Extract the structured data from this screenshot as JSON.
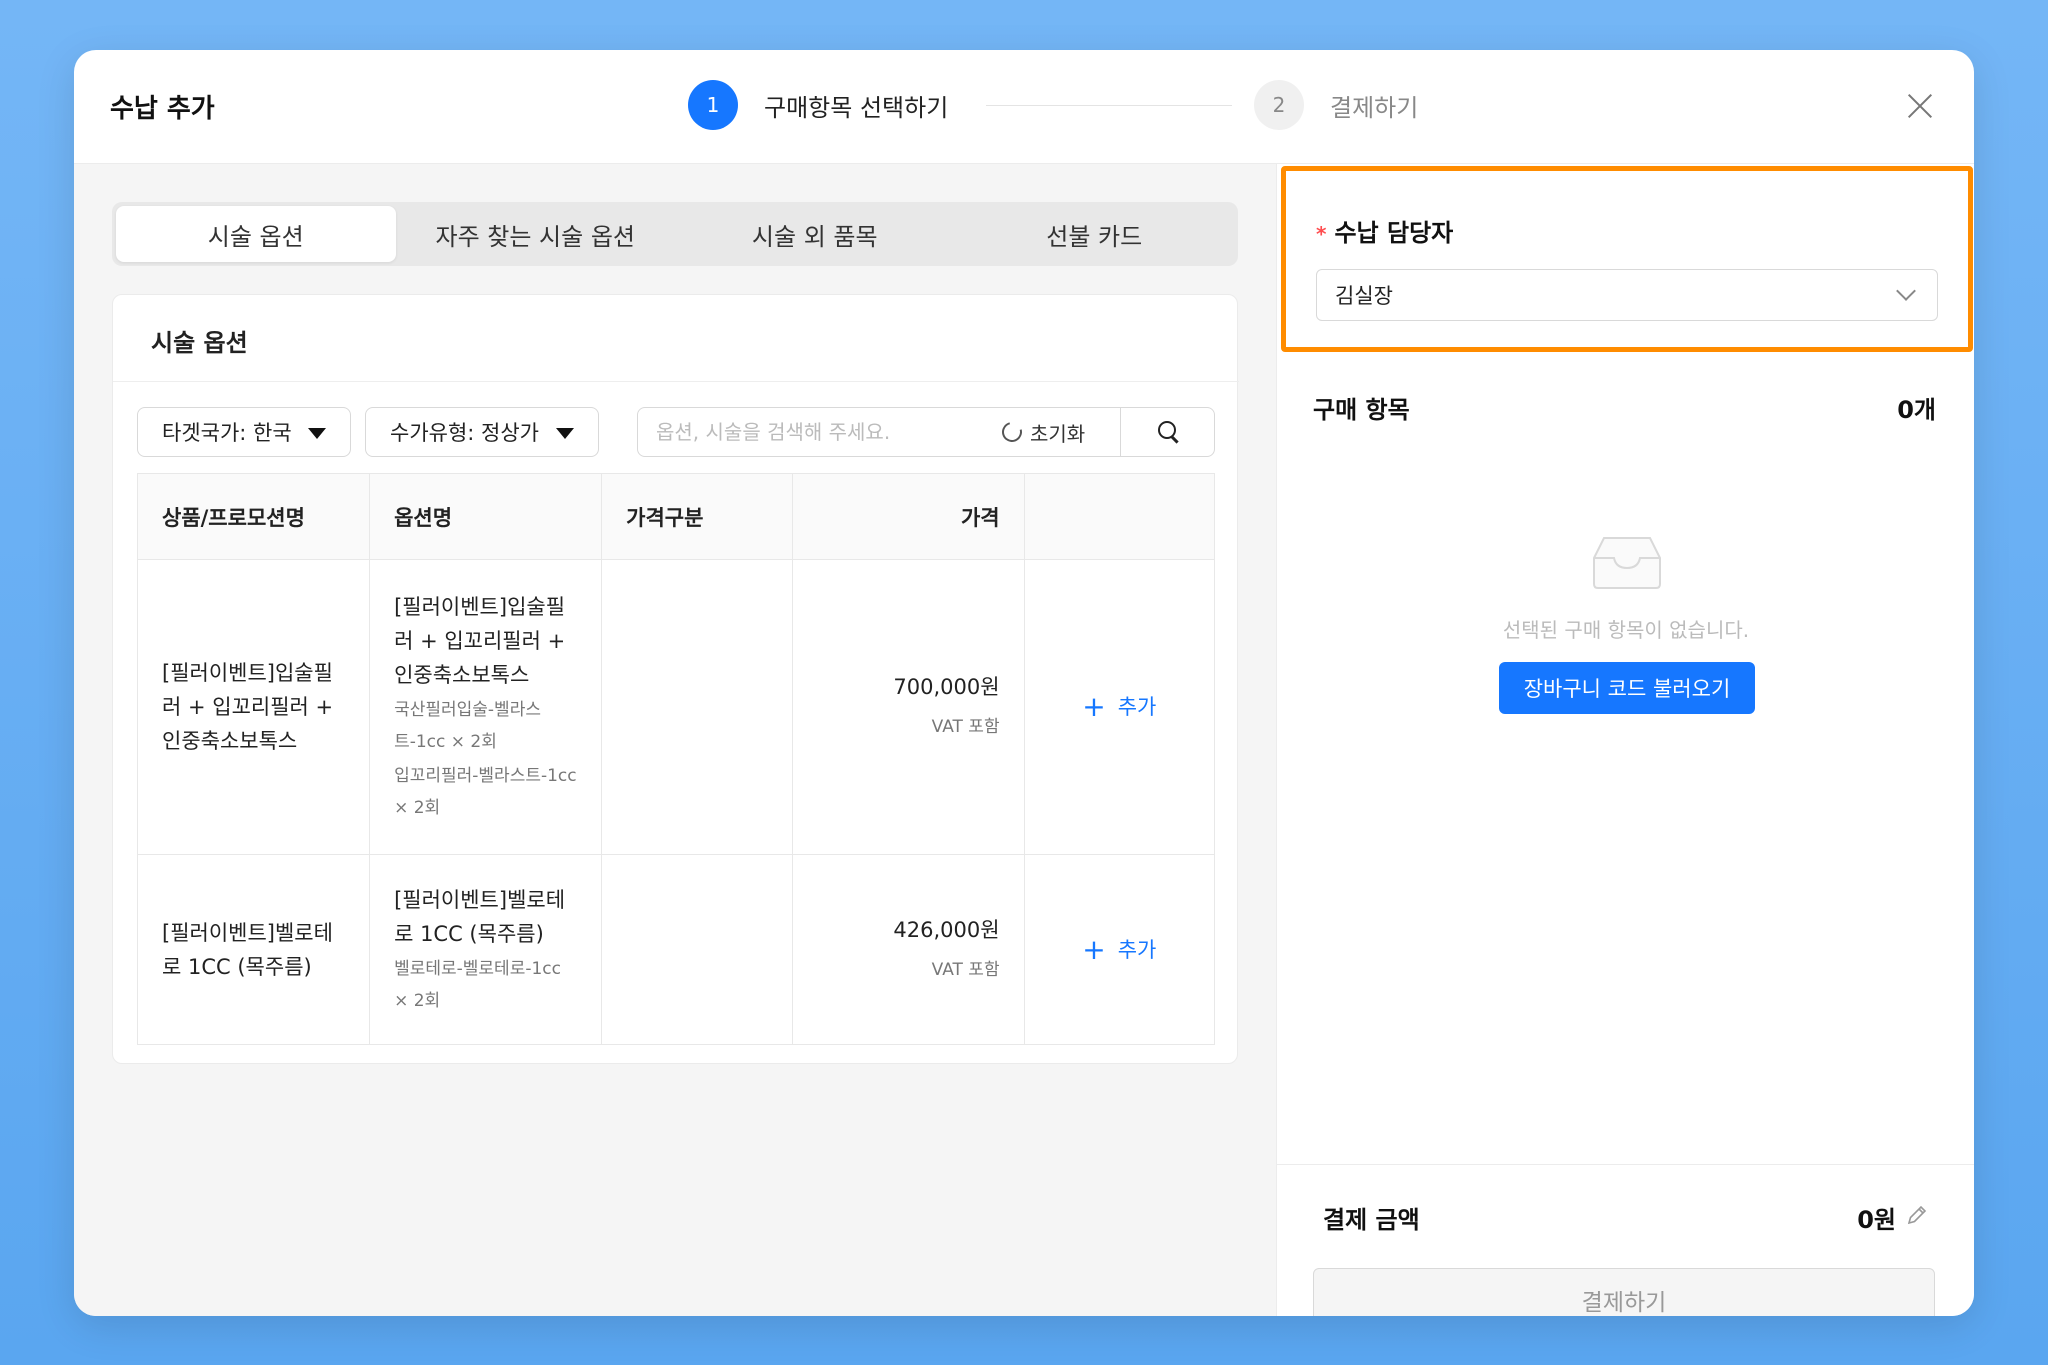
{
  "header": {
    "title": "수납 추가",
    "steps": [
      {
        "number": "1",
        "label": "구매항목 선택하기"
      },
      {
        "number": "2",
        "label": "결제하기"
      }
    ]
  },
  "tabs": [
    "시술 옵션",
    "자주 찾는 시술 옵션",
    "시술 외 품목",
    "선불 카드"
  ],
  "card": {
    "title": "시술 옵션",
    "filters": {
      "target_country": "타겟국가: 한국",
      "price_type": "수가유형: 정상가"
    },
    "search": {
      "placeholder": "옵션, 시술을 검색해 주세요.",
      "reset_label": "초기화"
    },
    "table": {
      "headers": [
        "상품/프로모션명",
        "옵션명",
        "가격구분",
        "가격",
        ""
      ],
      "rows": [
        {
          "product": "[필러이벤트]입술필러 + 입꼬리필러 + 인중축소보톡스",
          "option_name": "[필러이벤트]입술필러 + 입꼬리필러 + 인중축소보톡스",
          "option_details": [
            "국산필러입술-벨라스트-1cc × 2회",
            "입꼬리필러-벨라스트-1cc × 2회"
          ],
          "price_type": "",
          "price": "700,000원",
          "vat": "VAT 포함",
          "add_label": "추가"
        },
        {
          "product": "[필러이벤트]벨로테로 1CC (목주름)",
          "option_name": "[필러이벤트]벨로테로 1CC (목주름)",
          "option_details": [
            "벨로테로-벨로테로-1cc × 2회"
          ],
          "price_type": "",
          "price": "426,000원",
          "vat": "VAT 포함",
          "add_label": "추가"
        }
      ]
    }
  },
  "right": {
    "staff_label": "수납 담당자",
    "required_mark": "*",
    "staff_value": "김실장",
    "purchase_title": "구매 항목",
    "purchase_count": "0개",
    "empty_text": "선택된 구매 항목이 없습니다.",
    "cart_button": "장바구니 코드 불러오기",
    "pay_label": "결제 금액",
    "pay_amount": "0원",
    "pay_button": "결제하기"
  },
  "colors": {
    "accent": "#1677ff",
    "highlight": "#ff8c00",
    "background": "#5aa6f0"
  }
}
